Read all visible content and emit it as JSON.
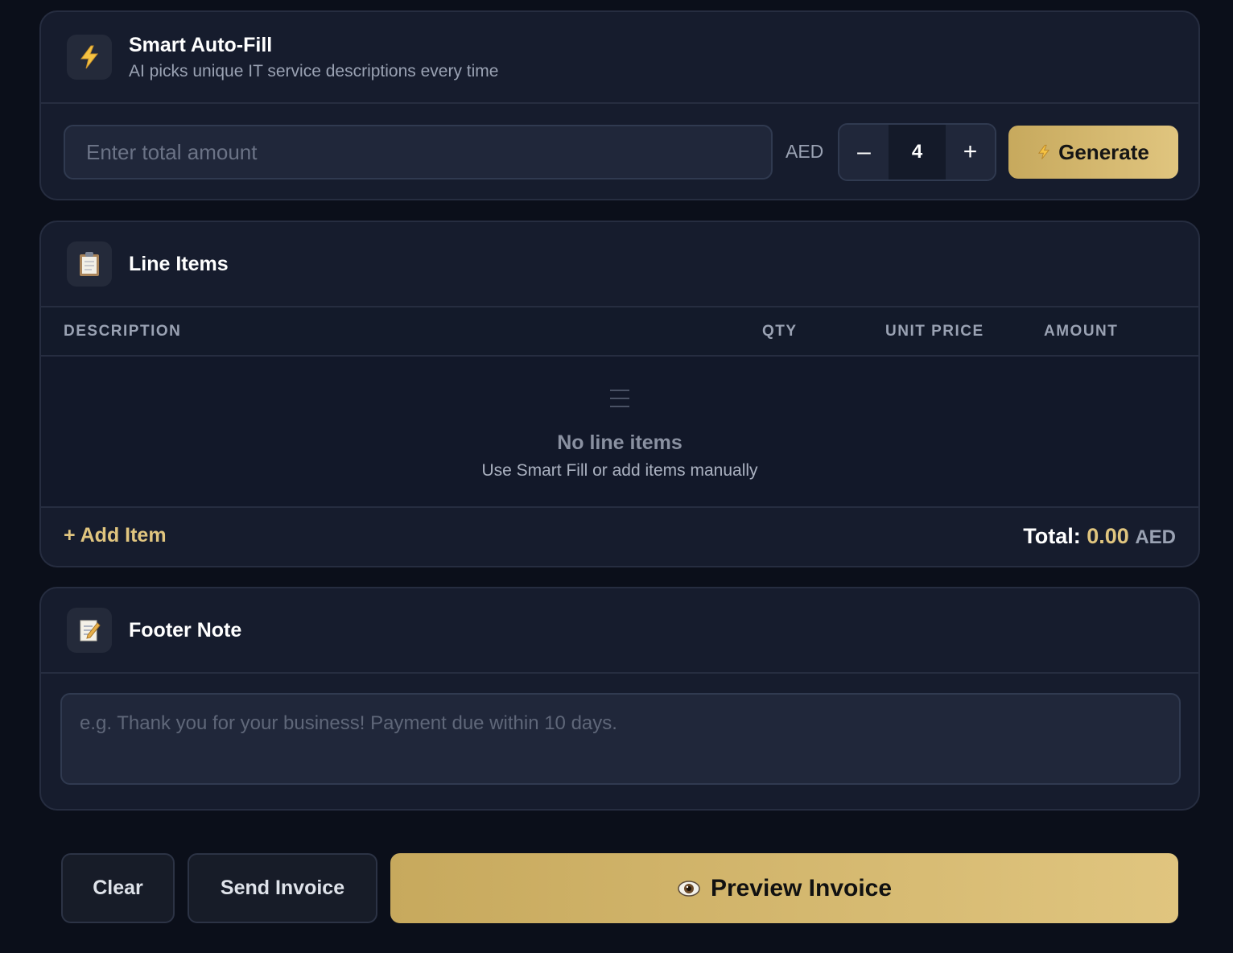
{
  "smart_autofill": {
    "icon": "lightning-icon",
    "title": "Smart Auto-Fill",
    "subtitle": "AI picks unique IT service descriptions every time",
    "amount_placeholder": "Enter total amount",
    "currency": "AED",
    "stepper": {
      "decrement": "–",
      "value": "4",
      "increment": "+"
    },
    "generate_label": "Generate"
  },
  "line_items": {
    "icon": "clipboard-icon",
    "title": "Line Items",
    "columns": [
      "DESCRIPTION",
      "QTY",
      "UNIT PRICE",
      "AMOUNT"
    ],
    "empty_icon": "list-icon",
    "empty_title": "No line items",
    "empty_subtitle": "Use Smart Fill or add items manually",
    "add_item_label": "+ Add Item",
    "total_label": "Total:",
    "total_value": "0.00",
    "total_currency": "AED"
  },
  "footer_note": {
    "icon": "memo-icon",
    "title": "Footer Note",
    "placeholder": "e.g. Thank you for your business! Payment due within 10 days."
  },
  "actions": {
    "clear_label": "Clear",
    "send_label": "Send Invoice",
    "preview_icon": "eye-icon",
    "preview_label": "Preview Invoice"
  },
  "colors": {
    "background": "#0b0f1a",
    "card": "#161c2d",
    "accent_gold": "#e0c57f",
    "accent_gold_dark": "#c7a95d"
  }
}
